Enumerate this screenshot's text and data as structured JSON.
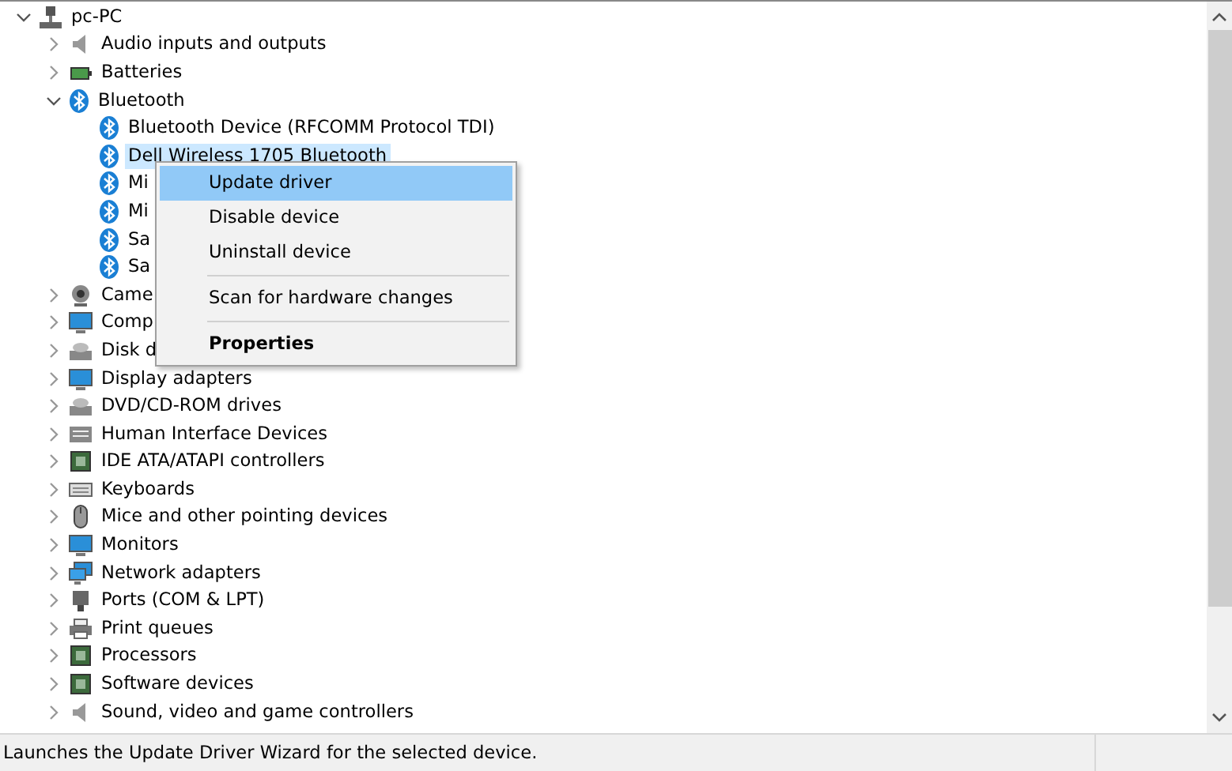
{
  "tree": {
    "label": "pc-PC",
    "expanded": true,
    "children": [
      {
        "label": "Audio inputs and outputs",
        "expanded": false,
        "selected": false
      },
      {
        "label": "Batteries",
        "expanded": false,
        "selected": false
      },
      {
        "label": "Bluetooth",
        "expanded": true,
        "selected": false,
        "children": [
          {
            "label": "Bluetooth Device (RFCOMM Protocol TDI)",
            "selected": false
          },
          {
            "label": "Dell Wireless 1705 Bluetooth",
            "selected": true
          },
          {
            "label": "Mi",
            "selected": false
          },
          {
            "label": "Mi",
            "selected": false
          },
          {
            "label": "Sa",
            "selected": false
          },
          {
            "label": "Sa",
            "selected": false
          }
        ]
      },
      {
        "label": "Came",
        "expanded": false,
        "selected": false
      },
      {
        "label": "Comp",
        "expanded": false,
        "selected": false
      },
      {
        "label": "Disk d",
        "expanded": false,
        "selected": false
      },
      {
        "label": "Display adapters",
        "expanded": false,
        "selected": false
      },
      {
        "label": "DVD/CD-ROM drives",
        "expanded": false,
        "selected": false
      },
      {
        "label": "Human Interface Devices",
        "expanded": false,
        "selected": false
      },
      {
        "label": "IDE ATA/ATAPI controllers",
        "expanded": false,
        "selected": false
      },
      {
        "label": "Keyboards",
        "expanded": false,
        "selected": false
      },
      {
        "label": "Mice and other pointing devices",
        "expanded": false,
        "selected": false
      },
      {
        "label": "Monitors",
        "expanded": false,
        "selected": false
      },
      {
        "label": "Network adapters",
        "expanded": false,
        "selected": false
      },
      {
        "label": "Ports (COM & LPT)",
        "expanded": false,
        "selected": false
      },
      {
        "label": "Print queues",
        "expanded": false,
        "selected": false
      },
      {
        "label": "Processors",
        "expanded": false,
        "selected": false
      },
      {
        "label": "Software devices",
        "expanded": false,
        "selected": false
      },
      {
        "label": "Sound, video and game controllers",
        "expanded": false,
        "selected": false
      }
    ]
  },
  "context_menu": {
    "items": [
      {
        "kind": "item",
        "label": "Update driver",
        "selected": true,
        "bold": false
      },
      {
        "kind": "item",
        "label": "Disable device",
        "selected": false,
        "bold": false
      },
      {
        "kind": "item",
        "label": "Uninstall device",
        "selected": false,
        "bold": false
      },
      {
        "kind": "separator"
      },
      {
        "kind": "item",
        "label": "Scan for hardware changes",
        "selected": false,
        "bold": false
      },
      {
        "kind": "separator"
      },
      {
        "kind": "item",
        "label": "Properties",
        "selected": false,
        "bold": true
      }
    ]
  },
  "status_bar": {
    "text": "Launches the Update Driver Wizard for the selected device."
  }
}
